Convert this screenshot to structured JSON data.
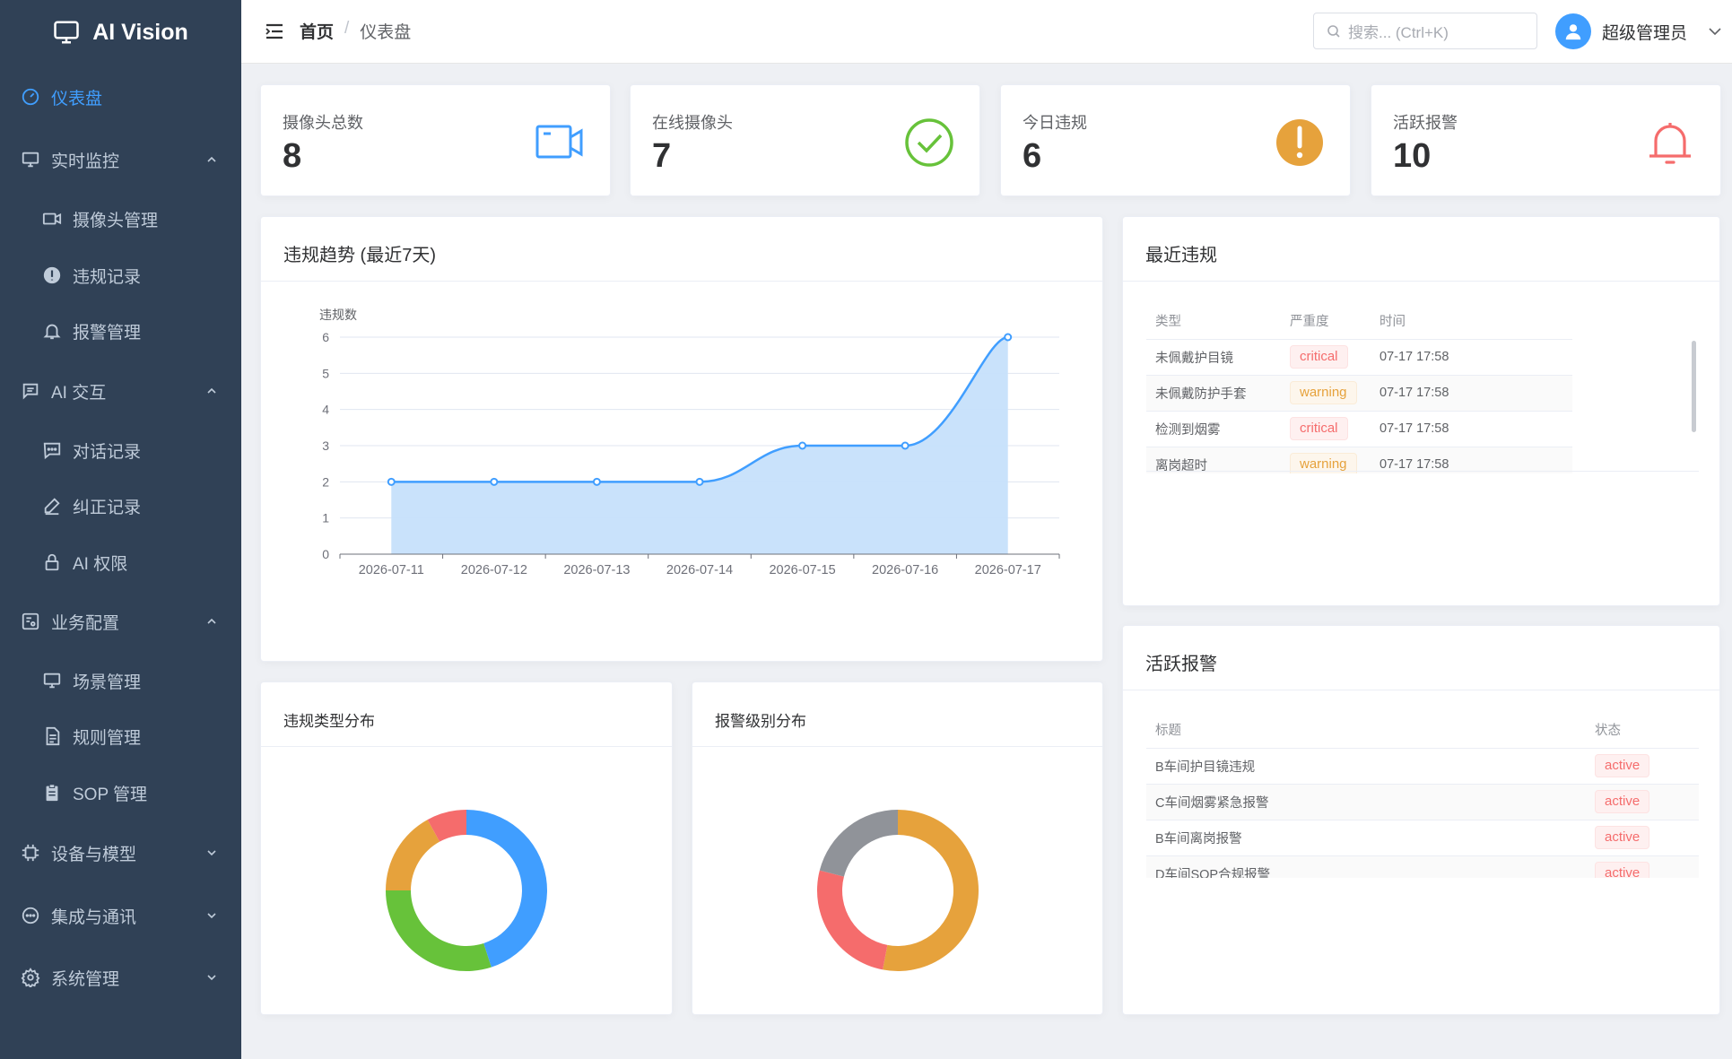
{
  "app": {
    "title": "AI Vision"
  },
  "sidebar": {
    "items": [
      {
        "label": "仪表盘",
        "icon": "dashboard-icon",
        "active": true
      },
      {
        "label": "实时监控",
        "icon": "monitor-icon",
        "expanded": true
      },
      {
        "label": "摄像头管理",
        "icon": "camera-icon"
      },
      {
        "label": "违规记录",
        "icon": "alert-circle-icon"
      },
      {
        "label": "报警管理",
        "icon": "bell-icon"
      },
      {
        "label": "AI 交互",
        "icon": "chat-icon",
        "expanded": true
      },
      {
        "label": "对话记录",
        "icon": "message-icon"
      },
      {
        "label": "纠正记录",
        "icon": "edit-icon"
      },
      {
        "label": "AI 权限",
        "icon": "lock-icon"
      },
      {
        "label": "业务配置",
        "icon": "config-icon",
        "expanded": true
      },
      {
        "label": "场景管理",
        "icon": "monitor-icon"
      },
      {
        "label": "规则管理",
        "icon": "document-icon"
      },
      {
        "label": "SOP 管理",
        "icon": "clipboard-icon"
      },
      {
        "label": "设备与模型",
        "icon": "chip-icon",
        "expanded": false
      },
      {
        "label": "集成与通讯",
        "icon": "chat-dots-icon",
        "expanded": false
      },
      {
        "label": "系统管理",
        "icon": "gear-icon",
        "expanded": false
      }
    ]
  },
  "header": {
    "breadcrumb": {
      "home": "首页",
      "separator": "/",
      "current": "仪表盘"
    },
    "search": {
      "placeholder": "搜索... (Ctrl+K)"
    },
    "user": {
      "name": "超级管理员"
    }
  },
  "stats": [
    {
      "label": "摄像头总数",
      "value": "8",
      "icon": "video-camera-icon",
      "color": "#409eff"
    },
    {
      "label": "在线摄像头",
      "value": "7",
      "icon": "check-circle-icon",
      "color": "#67c23a"
    },
    {
      "label": "今日违规",
      "value": "6",
      "icon": "warning-circle-icon",
      "color": "#e6a23c"
    },
    {
      "label": "活跃报警",
      "value": "10",
      "icon": "bell-icon",
      "color": "#f56c6c"
    }
  ],
  "trend": {
    "title": "违规趋势 (最近7天)",
    "chart_data": {
      "type": "area",
      "title": "",
      "xlabel": "",
      "ylabel": "违规数",
      "categories": [
        "2026-07-11",
        "2026-07-12",
        "2026-07-13",
        "2026-07-14",
        "2026-07-15",
        "2026-07-16",
        "2026-07-17"
      ],
      "values": [
        2,
        2,
        2,
        2,
        3,
        3,
        6
      ],
      "ylim": [
        0,
        6
      ],
      "yticks": [
        "0",
        "1",
        "2",
        "3",
        "4",
        "5",
        "6"
      ],
      "grid": true,
      "smooth": true,
      "color": "#409eff",
      "fill": "#c6e0fb"
    }
  },
  "recent_violations": {
    "title": "最近违规",
    "columns": [
      "类型",
      "严重度",
      "时间"
    ],
    "rows": [
      {
        "type": "未佩戴护目镜",
        "severity": "critical",
        "time": "07-17 17:58"
      },
      {
        "type": "未佩戴防护手套",
        "severity": "warning",
        "time": "07-17 17:58"
      },
      {
        "type": "检测到烟雾",
        "severity": "critical",
        "time": "07-17 17:58"
      },
      {
        "type": "离岗超时",
        "severity": "warning",
        "time": "07-17 17:58"
      }
    ]
  },
  "active_alarms": {
    "title": "活跃报警",
    "columns": [
      "标题",
      "状态"
    ],
    "rows": [
      {
        "title": "B车间护目镜违规",
        "status": "active"
      },
      {
        "title": "C车间烟雾紧急报警",
        "status": "active"
      },
      {
        "title": "B车间离岗报警",
        "status": "active"
      },
      {
        "title": "D车间SOP合规报警",
        "status": "active"
      }
    ]
  },
  "type_distribution": {
    "title": "违规类型分布",
    "chart_data": {
      "type": "pie",
      "donut": true,
      "slices": [
        {
          "value": 45,
          "color": "#409eff"
        },
        {
          "value": 30,
          "color": "#67c23a"
        },
        {
          "value": 17,
          "color": "#e6a23c"
        },
        {
          "value": 8,
          "color": "#f56c6c"
        }
      ]
    }
  },
  "level_distribution": {
    "title": "报警级别分布",
    "chart_data": {
      "type": "pie",
      "donut": true,
      "slices": [
        {
          "value": 53,
          "color": "#e6a23c"
        },
        {
          "value": 26,
          "color": "#f56c6c"
        },
        {
          "value": 21,
          "color": "#909399"
        }
      ]
    }
  }
}
